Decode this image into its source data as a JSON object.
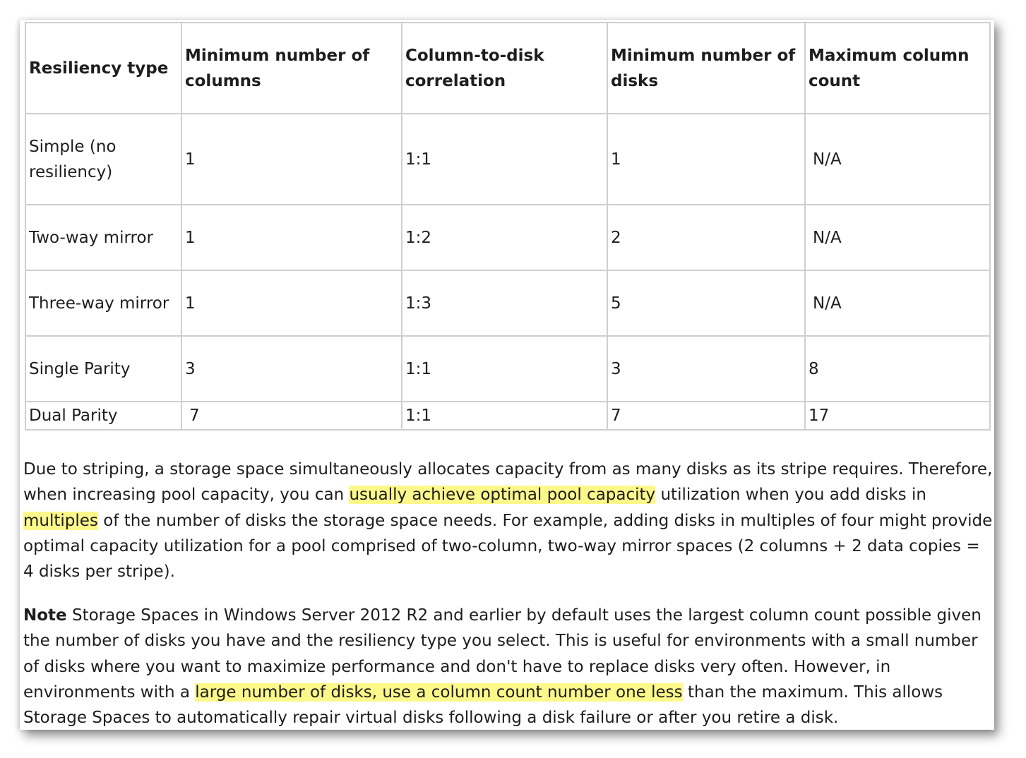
{
  "table": {
    "headers": [
      "Resiliency type",
      "Minimum number of columns",
      "Column-to-disk correlation",
      "Minimum number of disks",
      "Maximum column count"
    ],
    "rows": [
      [
        "Simple (no resiliency)",
        "1",
        "1:1",
        "1",
        "N/A"
      ],
      [
        "Two-way mirror",
        "1",
        "1:2",
        "2",
        "N/A"
      ],
      [
        "Three-way mirror",
        "1",
        "1:3",
        "5",
        "N/A"
      ],
      [
        "Single Parity",
        "3",
        "1:1",
        "3",
        "8"
      ],
      [
        "Dual Parity",
        "7",
        "1:1",
        "7",
        "17"
      ]
    ]
  },
  "paragraph1": {
    "t1": "Due to striping, a storage space simultaneously allocates capacity from as many disks as its stripe requires. Therefore, when increasing pool capacity, you can ",
    "h1": "usually achieve optimal pool capacity",
    "t2": " utilization when you add disks in ",
    "h2": "multiples",
    "t3": " of the number of disks the storage space needs. For example, adding disks in multiples of four might provide optimal capacity utilization for a pool comprised of two-column, two-way mirror spaces (2 columns + 2 data copies = 4 disks per stripe)."
  },
  "paragraph2": {
    "label": "Note",
    "t1": " Storage Spaces in Windows Server 2012 R2 and earlier by default uses the largest column count possible given the number of disks you have and the resiliency type you select. This is useful for environments with a small number of disks where you want to maximize performance and don't have to replace disks very often. However, in environments with a ",
    "h1": "large number of disks, use a column count number one less",
    "t2": " than the maximum. This allows Storage Spaces to automatically repair virtual disks following a disk failure or after you retire a disk."
  },
  "colors": {
    "highlight": "#fdf88a",
    "border": "#cfcfcf"
  }
}
